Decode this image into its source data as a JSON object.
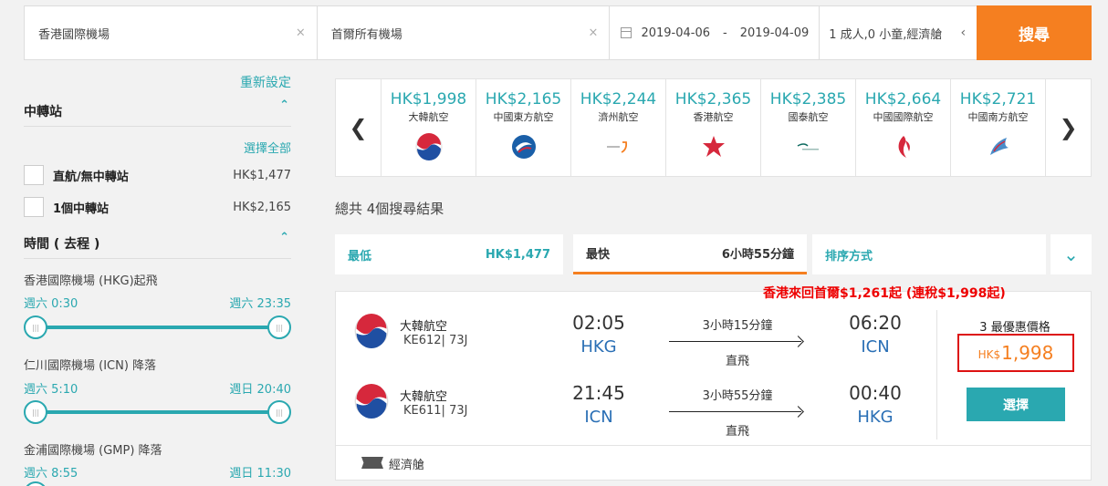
{
  "search": {
    "from": "香港國際機場",
    "to": "首爾所有機場",
    "date_start": "2019-04-06",
    "date_sep": "-",
    "date_end": "2019-04-09",
    "passengers": "1 成人,0 小童,經濟艙",
    "search_label": "搜尋",
    "clear_glyph": "×"
  },
  "sidebar": {
    "reset": "重新設定",
    "stops_title": "中轉站",
    "select_all": "選擇全部",
    "stop_options": [
      {
        "label": "直航/無中轉站",
        "price": "HK$1,477"
      },
      {
        "label": "1個中轉站",
        "price": "HK$2,165"
      }
    ],
    "time_title": "時間 ( 去程 )",
    "time_groups": [
      {
        "label": "香港國際機場 (HKG)起飛",
        "from": "週六 0:30",
        "to": "週六 23:35"
      },
      {
        "label": "仁川國際機場 (ICN) 降落",
        "from": "週六 5:10",
        "to": "週日 20:40"
      },
      {
        "label": "金浦國際機場 (GMP) 降落",
        "from": "週六 8:55",
        "to": "週日 11:30"
      }
    ]
  },
  "airlines": [
    {
      "price": "HK$1,998",
      "name": "大韓航空",
      "logo": "korean-air-logo"
    },
    {
      "price": "HK$2,165",
      "name": "中國東方航空",
      "logo": "china-eastern-logo"
    },
    {
      "price": "HK$2,244",
      "name": "濟州航空",
      "logo": "jeju-air-logo"
    },
    {
      "price": "HK$2,365",
      "name": "香港航空",
      "logo": "hong-kong-airlines-logo"
    },
    {
      "price": "HK$2,385",
      "name": "國泰航空",
      "logo": "cathay-pacific-logo"
    },
    {
      "price": "HK$2,664",
      "name": "中國國際航空",
      "logo": "air-china-logo"
    },
    {
      "price": "HK$2,721",
      "name": "中國南方航空",
      "logo": "china-southern-logo"
    }
  ],
  "results": {
    "count": "總共 4個搜尋結果",
    "sort": [
      {
        "label": "最低",
        "value": "HK$1,477"
      },
      {
        "label": "最快",
        "value": "6小時55分鐘"
      },
      {
        "label": "排序方式",
        "value": ""
      }
    ],
    "promo": "香港來回首爾$1,261起 (連稅$1,998起)",
    "legs": [
      {
        "airline": "大韓航空",
        "code": "KE612| 73J",
        "dep_time": "02:05",
        "dep_ap": "HKG",
        "duration": "3小時15分鐘",
        "stops": "直飛",
        "arr_time": "06:20",
        "arr_ap": "ICN"
      },
      {
        "airline": "大韓航空",
        "code": "KE611| 73J",
        "dep_time": "21:45",
        "dep_ap": "ICN",
        "duration": "3小時55分鐘",
        "stops": "直飛",
        "arr_time": "00:40",
        "arr_ap": "HKG"
      }
    ],
    "best_price_label": "3 最優惠價格",
    "price_currency": "HK$",
    "price_amount": "1,998",
    "select_label": "選擇",
    "cabin": "經濟艙"
  },
  "colors": {
    "accent": "#2aa8b0",
    "orange": "#f57f20",
    "promo_red": "#ee0000"
  }
}
